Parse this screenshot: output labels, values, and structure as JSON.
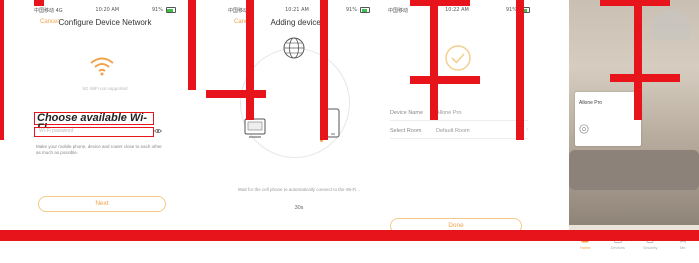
{
  "phone1": {
    "status": {
      "carrier": "中国移动 4G",
      "time": "10:20 AM",
      "battery": "91%"
    },
    "nav": {
      "back": "Cancel",
      "title": "Configure Device Network"
    },
    "notice": "5G WiFi not supported",
    "choose_wifi": "Choose available Wi-Fi",
    "password_placeholder": "Wi-Fi password",
    "help_text": "Make your mobile phone, device and router close to each other as much as possible.",
    "next_label": "Next"
  },
  "phone2": {
    "status": {
      "carrier": "中国移动",
      "time": "10:21 AM",
      "battery": "91%"
    },
    "nav": {
      "back": "Cancel",
      "title": "Adding device..."
    },
    "wait_text": "Wait for the cell phone to automatically connect to the Wi-Fi...",
    "countdown": "30s"
  },
  "phone3": {
    "status": {
      "carrier": "中国移动",
      "time": "10:22 AM",
      "battery": "91%"
    },
    "added_text": "Added successfully",
    "rows": [
      {
        "label": "Device Name",
        "value": "Allone Pro"
      },
      {
        "label": "Select Room",
        "value": "Default Room"
      }
    ],
    "done_label": "Done"
  },
  "phone4": {
    "device_name": "Allone Pro",
    "tabs": [
      {
        "label": "Home",
        "active": true
      },
      {
        "label": "Devices",
        "active": false
      },
      {
        "label": "Security",
        "active": false
      },
      {
        "label": "Me",
        "active": false
      }
    ]
  },
  "colors": {
    "accent": "#f3a14a",
    "overlay_red": "#e8141b"
  }
}
